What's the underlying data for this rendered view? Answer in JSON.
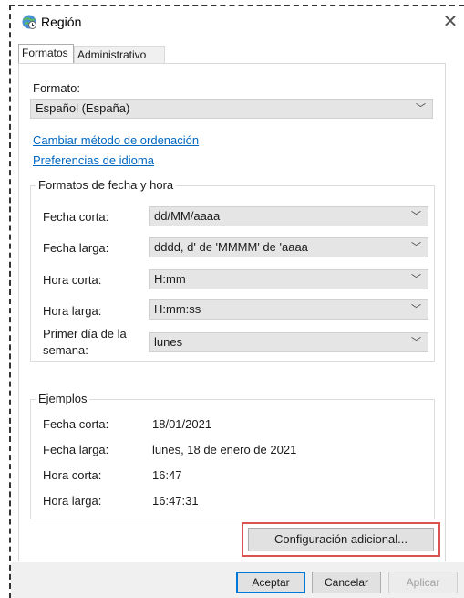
{
  "window": {
    "title": "Región",
    "close_glyph": "✕"
  },
  "tabs": [
    {
      "label": "Formatos",
      "active": true
    },
    {
      "label": "Administrativo",
      "active": false
    }
  ],
  "format": {
    "label": "Formato:",
    "value": "Español (España)"
  },
  "links": {
    "sort_method": "Cambiar método de ordenación",
    "language_prefs": "Preferencias de idioma"
  },
  "date_time_formats": {
    "title": "Formatos de fecha y hora",
    "rows": [
      {
        "label": "Fecha corta:",
        "value": "dd/MM/aaaa"
      },
      {
        "label": "Fecha larga:",
        "value": "dddd, d' de 'MMMM' de 'aaaa"
      },
      {
        "label": "Hora corta:",
        "value": "H:mm"
      },
      {
        "label": "Hora larga:",
        "value": "H:mm:ss"
      },
      {
        "label": "Primer día de la",
        "label2": "semana:",
        "value": "lunes"
      }
    ]
  },
  "examples": {
    "title": "Ejemplos",
    "rows": [
      {
        "label": "Fecha corta:",
        "value": "18/01/2021"
      },
      {
        "label": "Fecha larga:",
        "value": "lunes, 18 de enero de 2021"
      },
      {
        "label": "Hora corta:",
        "value": "16:47"
      },
      {
        "label": "Hora larga:",
        "value": "16:47:31"
      }
    ]
  },
  "buttons": {
    "additional": "Configuración adicional...",
    "ok": "Aceptar",
    "cancel": "Cancelar",
    "apply": "Aplicar"
  },
  "icons": {
    "window": "globe-clock-icon",
    "chevron": "chevron-down-icon"
  },
  "colors": {
    "link": "#0067c0",
    "highlight_border": "#d9534f",
    "combo_bg": "#e5e5e5"
  }
}
